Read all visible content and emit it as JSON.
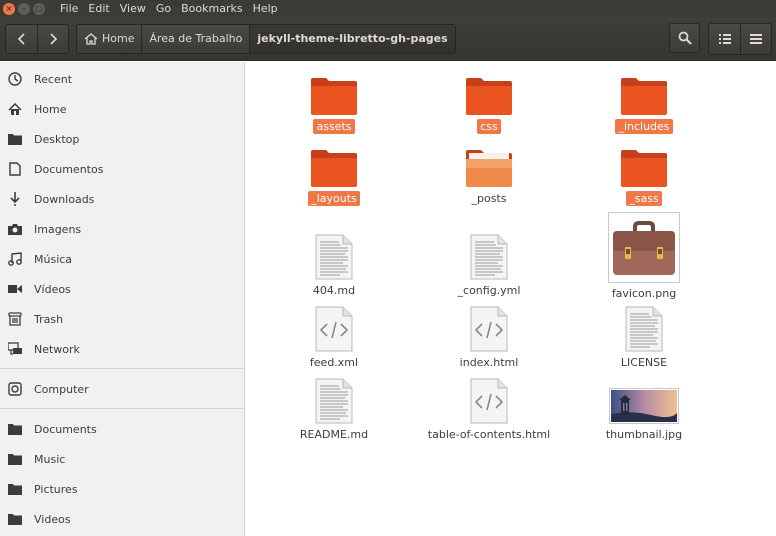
{
  "menubar": {
    "items": [
      "File",
      "Edit",
      "View",
      "Go",
      "Bookmarks",
      "Help"
    ]
  },
  "breadcrumb": {
    "home": "Home",
    "parent": "Área de Trabalho",
    "current": "jekyll-theme-libretto-gh-pages"
  },
  "sidebar": {
    "group1": [
      {
        "label": "Recent",
        "icon": "clock-icon"
      },
      {
        "label": "Home",
        "icon": "home-icon"
      },
      {
        "label": "Desktop",
        "icon": "folder-icon"
      },
      {
        "label": "Documentos",
        "icon": "document-icon"
      },
      {
        "label": "Downloads",
        "icon": "download-icon"
      },
      {
        "label": "Imagens",
        "icon": "camera-icon"
      },
      {
        "label": "Música",
        "icon": "music-icon"
      },
      {
        "label": "Vídeos",
        "icon": "video-icon"
      },
      {
        "label": "Trash",
        "icon": "trash-icon"
      },
      {
        "label": "Network",
        "icon": "network-icon"
      }
    ],
    "group2": [
      {
        "label": "Computer",
        "icon": "drive-icon"
      }
    ],
    "group3": [
      {
        "label": "Documents",
        "icon": "folder-icon"
      },
      {
        "label": "Music",
        "icon": "folder-icon"
      },
      {
        "label": "Pictures",
        "icon": "folder-icon"
      },
      {
        "label": "Videos",
        "icon": "folder-icon"
      }
    ]
  },
  "files": [
    {
      "name": "assets",
      "type": "folder",
      "selected": true
    },
    {
      "name": "css",
      "type": "folder",
      "selected": true
    },
    {
      "name": "_includes",
      "type": "folder",
      "selected": true
    },
    {
      "name": "_layouts",
      "type": "folder",
      "selected": true
    },
    {
      "name": "_posts",
      "type": "folder-open",
      "selected": false
    },
    {
      "name": "_sass",
      "type": "folder",
      "selected": true
    },
    {
      "name": "404.md",
      "type": "text",
      "selected": false
    },
    {
      "name": "_config.yml",
      "type": "text",
      "selected": false
    },
    {
      "name": "favicon.png",
      "type": "image-briefcase",
      "selected": false
    },
    {
      "name": "feed.xml",
      "type": "code",
      "selected": false
    },
    {
      "name": "index.html",
      "type": "code",
      "selected": false
    },
    {
      "name": "LICENSE",
      "type": "text",
      "selected": false
    },
    {
      "name": "README.md",
      "type": "text",
      "selected": false
    },
    {
      "name": "table-of-contents.html",
      "type": "code",
      "selected": false
    },
    {
      "name": "thumbnail.jpg",
      "type": "image-photo",
      "selected": false
    }
  ],
  "colors": {
    "accent": "#f07746",
    "folder": "#e95420",
    "dark_bar": "#3c3b37"
  }
}
